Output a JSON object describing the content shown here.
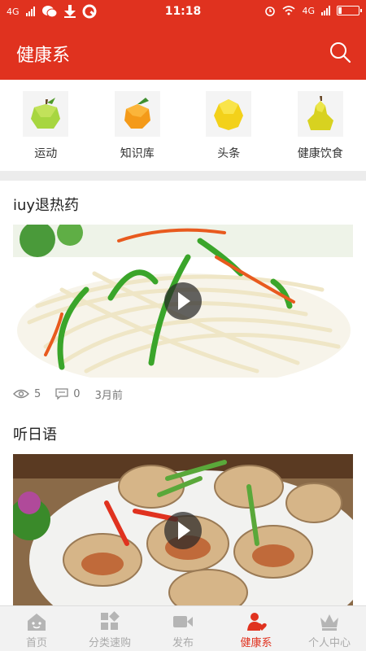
{
  "status_bar": {
    "net1": "4G",
    "time": "11:18",
    "net2": "4G"
  },
  "header": {
    "title": "健康系",
    "search_icon": "search-icon"
  },
  "categories": [
    {
      "label": "运动",
      "icon": "green-apple-icon"
    },
    {
      "label": "知识库",
      "icon": "orange-icon"
    },
    {
      "label": "头条",
      "icon": "lemon-icon"
    },
    {
      "label": "健康饮食",
      "icon": "pear-icon"
    }
  ],
  "posts": [
    {
      "title": "iuy退热药",
      "views": "5",
      "comments": "0",
      "time": "3月前"
    },
    {
      "title": "听日语"
    }
  ],
  "tabs": [
    {
      "label": "首页",
      "icon": "home-icon"
    },
    {
      "label": "分类速购",
      "icon": "grid-icon"
    },
    {
      "label": "发布",
      "icon": "video-camera-icon"
    },
    {
      "label": "健康系",
      "icon": "heart-person-icon",
      "active": true
    },
    {
      "label": "个人中心",
      "icon": "crown-icon"
    }
  ],
  "colors": {
    "brand": "#e0321f",
    "separator": "#ececec",
    "tab_inactive": "#aaaaaa"
  }
}
